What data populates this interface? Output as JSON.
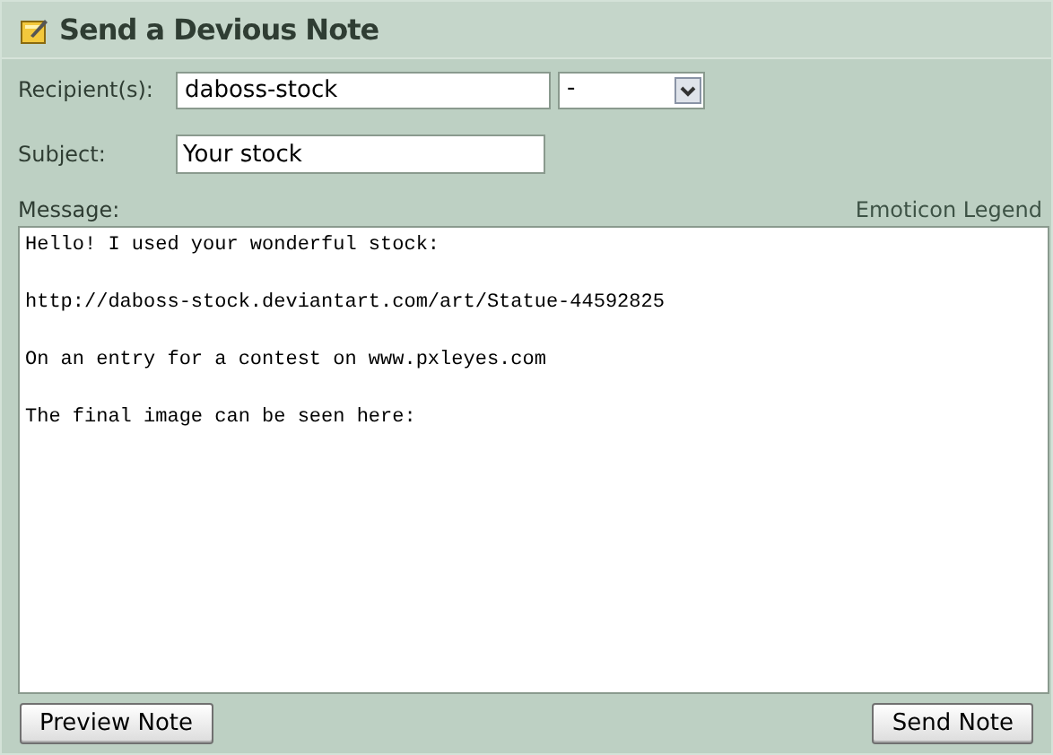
{
  "title": "Send a Devious Note",
  "recipient": {
    "label": "Recipient(s):",
    "value": "daboss-stock",
    "dropdown": "-"
  },
  "subject": {
    "label": "Subject:",
    "value": "Your stock"
  },
  "message": {
    "label": "Message:",
    "legend_link": "Emoticon Legend",
    "paragraphs": [
      "Hello! I used your wonderful stock:",
      "http://daboss-stock.deviantart.com/art/Statue-44592825",
      "On an entry for a contest on www.pxleyes.com",
      "The final image can be seen here:"
    ]
  },
  "buttons": [
    {
      "label": "Preview Note",
      "kind": "preview"
    },
    {
      "label": "Send Note",
      "kind": "send"
    }
  ]
}
